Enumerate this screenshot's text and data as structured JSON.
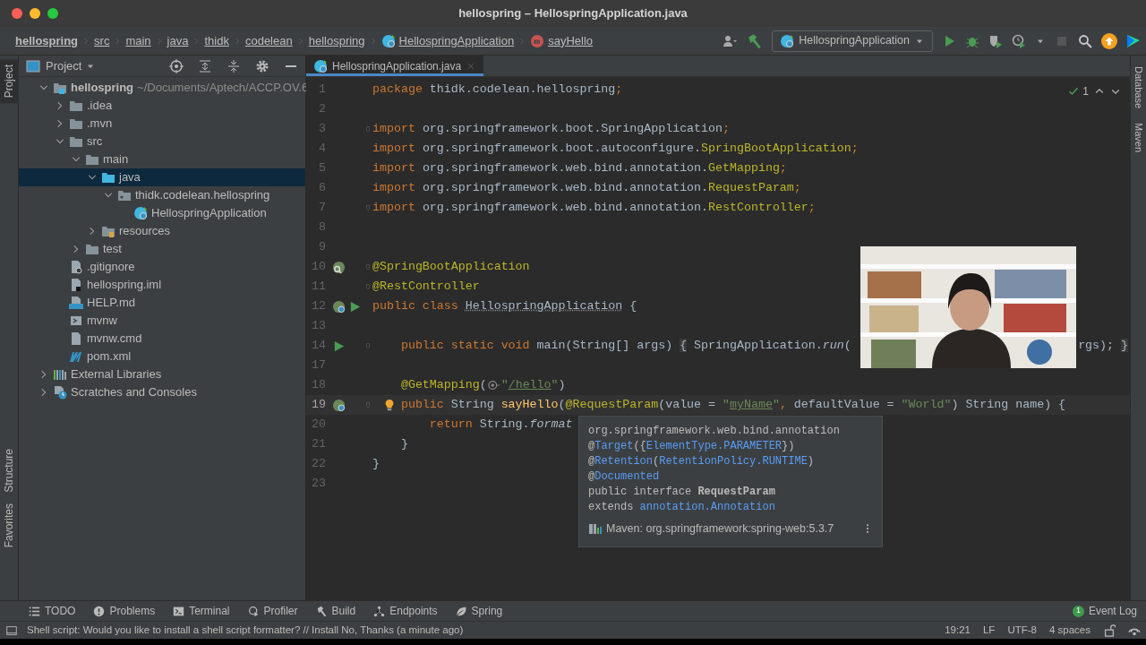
{
  "window": {
    "title": "hellospring – HellospringApplication.java"
  },
  "breadcrumbs": [
    {
      "label": "hellospring",
      "kind": "project"
    },
    {
      "label": "src",
      "kind": "folder"
    },
    {
      "label": "main",
      "kind": "folder"
    },
    {
      "label": "java",
      "kind": "folder"
    },
    {
      "label": "thidk",
      "kind": "folder"
    },
    {
      "label": "codelean",
      "kind": "folder"
    },
    {
      "label": "hellospring",
      "kind": "folder"
    },
    {
      "label": "HellospringApplication",
      "kind": "class"
    },
    {
      "label": "sayHello",
      "kind": "method"
    }
  ],
  "run_config": {
    "label": "HellospringApplication"
  },
  "left_strip": [
    {
      "label": "Project",
      "selected": true
    },
    {
      "label": "Structure",
      "selected": false
    },
    {
      "label": "Favorites",
      "selected": false
    }
  ],
  "right_strip": [
    {
      "label": "Database"
    },
    {
      "label": "Maven"
    }
  ],
  "project_panel": {
    "title": "Project"
  },
  "project_tree": [
    {
      "label": "hellospring",
      "kind": "module",
      "path": "~/Documents/Aptech/ACCP.OV.6",
      "expanded": true,
      "selected": false,
      "children": [
        {
          "label": ".idea",
          "kind": "folder",
          "expanded": false,
          "selected": false
        },
        {
          "label": ".mvn",
          "kind": "folder",
          "expanded": false,
          "selected": false
        },
        {
          "label": "src",
          "kind": "folder",
          "expanded": true,
          "selected": false,
          "children": [
            {
              "label": "main",
              "kind": "folder",
              "expanded": true,
              "selected": false,
              "children": [
                {
                  "label": "java",
                  "kind": "source",
                  "expanded": true,
                  "selected": true,
                  "children": [
                    {
                      "label": "thidk.codelean.hellospring",
                      "kind": "package",
                      "expanded": true,
                      "selected": false,
                      "children": [
                        {
                          "label": "HellospringApplication",
                          "kind": "springclass",
                          "selected": false
                        }
                      ]
                    }
                  ]
                },
                {
                  "label": "resources",
                  "kind": "resources",
                  "expanded": false,
                  "selected": false
                }
              ]
            },
            {
              "label": "test",
              "kind": "folder",
              "expanded": false,
              "selected": false
            }
          ]
        },
        {
          "label": ".gitignore",
          "kind": "ignore",
          "selected": false
        },
        {
          "label": "hellospring.iml",
          "kind": "iml",
          "selected": false
        },
        {
          "label": "HELP.md",
          "kind": "md",
          "selected": false
        },
        {
          "label": "mvnw",
          "kind": "script",
          "selected": false
        },
        {
          "label": "mvnw.cmd",
          "kind": "file",
          "selected": false
        },
        {
          "label": "pom.xml",
          "kind": "maven",
          "selected": false
        }
      ]
    },
    {
      "label": "External Libraries",
      "kind": "libraries",
      "expanded": false,
      "selected": false
    },
    {
      "label": "Scratches and Consoles",
      "kind": "scratches",
      "expanded": false,
      "selected": false
    }
  ],
  "editor_tabs": [
    {
      "label": "HellospringApplication.java",
      "selected": true
    }
  ],
  "inspection": {
    "count": "1"
  },
  "code_lines": [
    {
      "n": "1",
      "tokens": [
        {
          "kind": "kw",
          "text": "package"
        },
        {
          "kind": "txt",
          "text": " thidk.codelean.hellospring"
        },
        {
          "kind": "kw",
          "text": ";"
        }
      ]
    },
    {
      "n": "2"
    },
    {
      "n": "3",
      "fold": true,
      "tokens": [
        {
          "kind": "kw",
          "text": "import"
        },
        {
          "kind": "txt",
          "text": " org.springframework.boot.SpringApplication"
        },
        {
          "kind": "kw",
          "text": ";"
        }
      ]
    },
    {
      "n": "4",
      "tokens": [
        {
          "kind": "kw",
          "text": "import"
        },
        {
          "kind": "txt",
          "text": " org.springframework.boot.autoconfigure."
        },
        {
          "kind": "ann",
          "text": "SpringBootApplication"
        },
        {
          "kind": "kw",
          "text": ";"
        }
      ]
    },
    {
      "n": "5",
      "tokens": [
        {
          "kind": "kw",
          "text": "import"
        },
        {
          "kind": "txt",
          "text": " org.springframework.web.bind.annotation."
        },
        {
          "kind": "ann",
          "text": "GetMapping"
        },
        {
          "kind": "kw",
          "text": ";"
        }
      ]
    },
    {
      "n": "6",
      "tokens": [
        {
          "kind": "kw",
          "text": "import"
        },
        {
          "kind": "txt",
          "text": " org.springframework.web.bind.annotation."
        },
        {
          "kind": "ann",
          "text": "RequestParam"
        },
        {
          "kind": "kw",
          "text": ";"
        }
      ]
    },
    {
      "n": "7",
      "fold": true,
      "tokens": [
        {
          "kind": "kw",
          "text": "import"
        },
        {
          "kind": "txt",
          "text": " org.springframework.web.bind.annotation."
        },
        {
          "kind": "ann",
          "text": "RestController"
        },
        {
          "kind": "kw",
          "text": ";"
        }
      ]
    },
    {
      "n": "8"
    },
    {
      "n": "9"
    },
    {
      "n": "10",
      "fold": true,
      "gutter": [
        {
          "kind": "bean-search"
        }
      ],
      "tokens": [
        {
          "kind": "ann",
          "text": "@SpringBootApplication"
        }
      ]
    },
    {
      "n": "11",
      "fold": true,
      "tokens": [
        {
          "kind": "ann",
          "text": "@RestController"
        }
      ]
    },
    {
      "n": "12",
      "gutter": [
        {
          "kind": "bean"
        },
        {
          "kind": "run"
        }
      ],
      "tokens": [
        {
          "kind": "kw",
          "text": "public class "
        },
        {
          "kind": "cls",
          "text": "HellospringApplication"
        },
        {
          "kind": "txt",
          "text": " {"
        }
      ]
    },
    {
      "n": "13"
    },
    {
      "n": "14",
      "fold": true,
      "gutter": [
        {
          "kind": "run"
        }
      ],
      "tokens": [
        {
          "kind": "kw",
          "text": "    public static void "
        },
        {
          "kind": "txt",
          "text": "main(String[] args) "
        },
        {
          "kind": "brace",
          "text": "{"
        },
        {
          "kind": "txt",
          "text": " SpringApplication."
        },
        {
          "kind": "it",
          "text": "run"
        },
        {
          "kind": "txt",
          "text": "("
        }
      ],
      "tail": [
        {
          "kind": "txt",
          "text": "rgs); "
        },
        {
          "kind": "brace",
          "text": "}"
        }
      ]
    },
    {
      "n": "17"
    },
    {
      "n": "18",
      "tokens": [
        {
          "kind": "ann",
          "text": "    @GetMapping"
        },
        {
          "kind": "txt",
          "text": "("
        },
        {
          "kind": "icon"
        },
        {
          "kind": "str",
          "text": "\""
        },
        {
          "kind": "link",
          "text": "/hello"
        },
        {
          "kind": "str",
          "text": "\""
        },
        {
          "kind": "txt",
          "text": ")"
        }
      ]
    },
    {
      "n": "19",
      "fold": true,
      "current": true,
      "intention": true,
      "gutter": [
        {
          "kind": "bean"
        }
      ],
      "tokens": [
        {
          "kind": "kw",
          "text": "    public "
        },
        {
          "kind": "txt",
          "text": "String "
        },
        {
          "kind": "fn",
          "text": "sayHello"
        },
        {
          "kind": "txt",
          "text": "("
        },
        {
          "kind": "ann",
          "text": "@RequestParam"
        },
        {
          "kind": "txt",
          "text": "(value = "
        },
        {
          "kind": "str",
          "text": "\""
        },
        {
          "kind": "link",
          "text": "myName"
        },
        {
          "kind": "str",
          "text": "\""
        },
        {
          "kind": "kw",
          "text": ","
        },
        {
          "kind": "txt",
          "text": " defaultValue = "
        },
        {
          "kind": "str",
          "text": "\"World\""
        },
        {
          "kind": "txt",
          "text": ") String name) {"
        }
      ]
    },
    {
      "n": "20",
      "tokens": [
        {
          "kind": "kw",
          "text": "        return "
        },
        {
          "kind": "txt",
          "text": "String."
        },
        {
          "kind": "it",
          "text": "format"
        }
      ]
    },
    {
      "n": "21",
      "tokens": [
        {
          "kind": "txt",
          "text": "    }"
        }
      ]
    },
    {
      "n": "22",
      "tokens": [
        {
          "kind": "txt",
          "text": "}"
        }
      ]
    },
    {
      "n": "23"
    }
  ],
  "doc_popup": {
    "lines": [
      [
        {
          "kind": "txt",
          "text": "org.springframework.web.bind.annotation"
        }
      ],
      [
        {
          "kind": "txt",
          "text": "@"
        },
        {
          "kind": "link",
          "text": "Target"
        },
        {
          "kind": "txt",
          "text": "({"
        },
        {
          "kind": "link",
          "text": "ElementType.PARAMETER"
        },
        {
          "kind": "txt",
          "text": "})"
        }
      ],
      [
        {
          "kind": "txt",
          "text": "@"
        },
        {
          "kind": "link",
          "text": "Retention"
        },
        {
          "kind": "txt",
          "text": "("
        },
        {
          "kind": "link",
          "text": "RetentionPolicy.RUNTIME"
        },
        {
          "kind": "txt",
          "text": ")"
        }
      ],
      [
        {
          "kind": "txt",
          "text": "@"
        },
        {
          "kind": "link",
          "text": "Documented"
        }
      ],
      [
        {
          "kind": "txt",
          "text": "public interface "
        },
        {
          "kind": "bold",
          "text": "RequestParam"
        }
      ],
      [
        {
          "kind": "txt",
          "text": "extends "
        },
        {
          "kind": "link",
          "text": "annotation.Annotation"
        }
      ]
    ],
    "footer": "Maven: org.springframework:spring-web:5.3.7"
  },
  "tool_tabs": [
    {
      "label": "TODO",
      "kind": "todo"
    },
    {
      "label": "Problems",
      "kind": "problems"
    },
    {
      "label": "Terminal",
      "kind": "terminal"
    },
    {
      "label": "Profiler",
      "kind": "profiler"
    },
    {
      "label": "Build",
      "kind": "build"
    },
    {
      "label": "Endpoints",
      "kind": "endpoints"
    },
    {
      "label": "Spring",
      "kind": "spring"
    }
  ],
  "event_log": {
    "label": "Event Log",
    "count": "1"
  },
  "status_bar": {
    "message": "Shell script: Would you like to install a shell script formatter? // Install   No, Thanks (a minute ago)",
    "items": [
      "19:21",
      "LF",
      "UTF-8",
      "4 spaces"
    ]
  }
}
